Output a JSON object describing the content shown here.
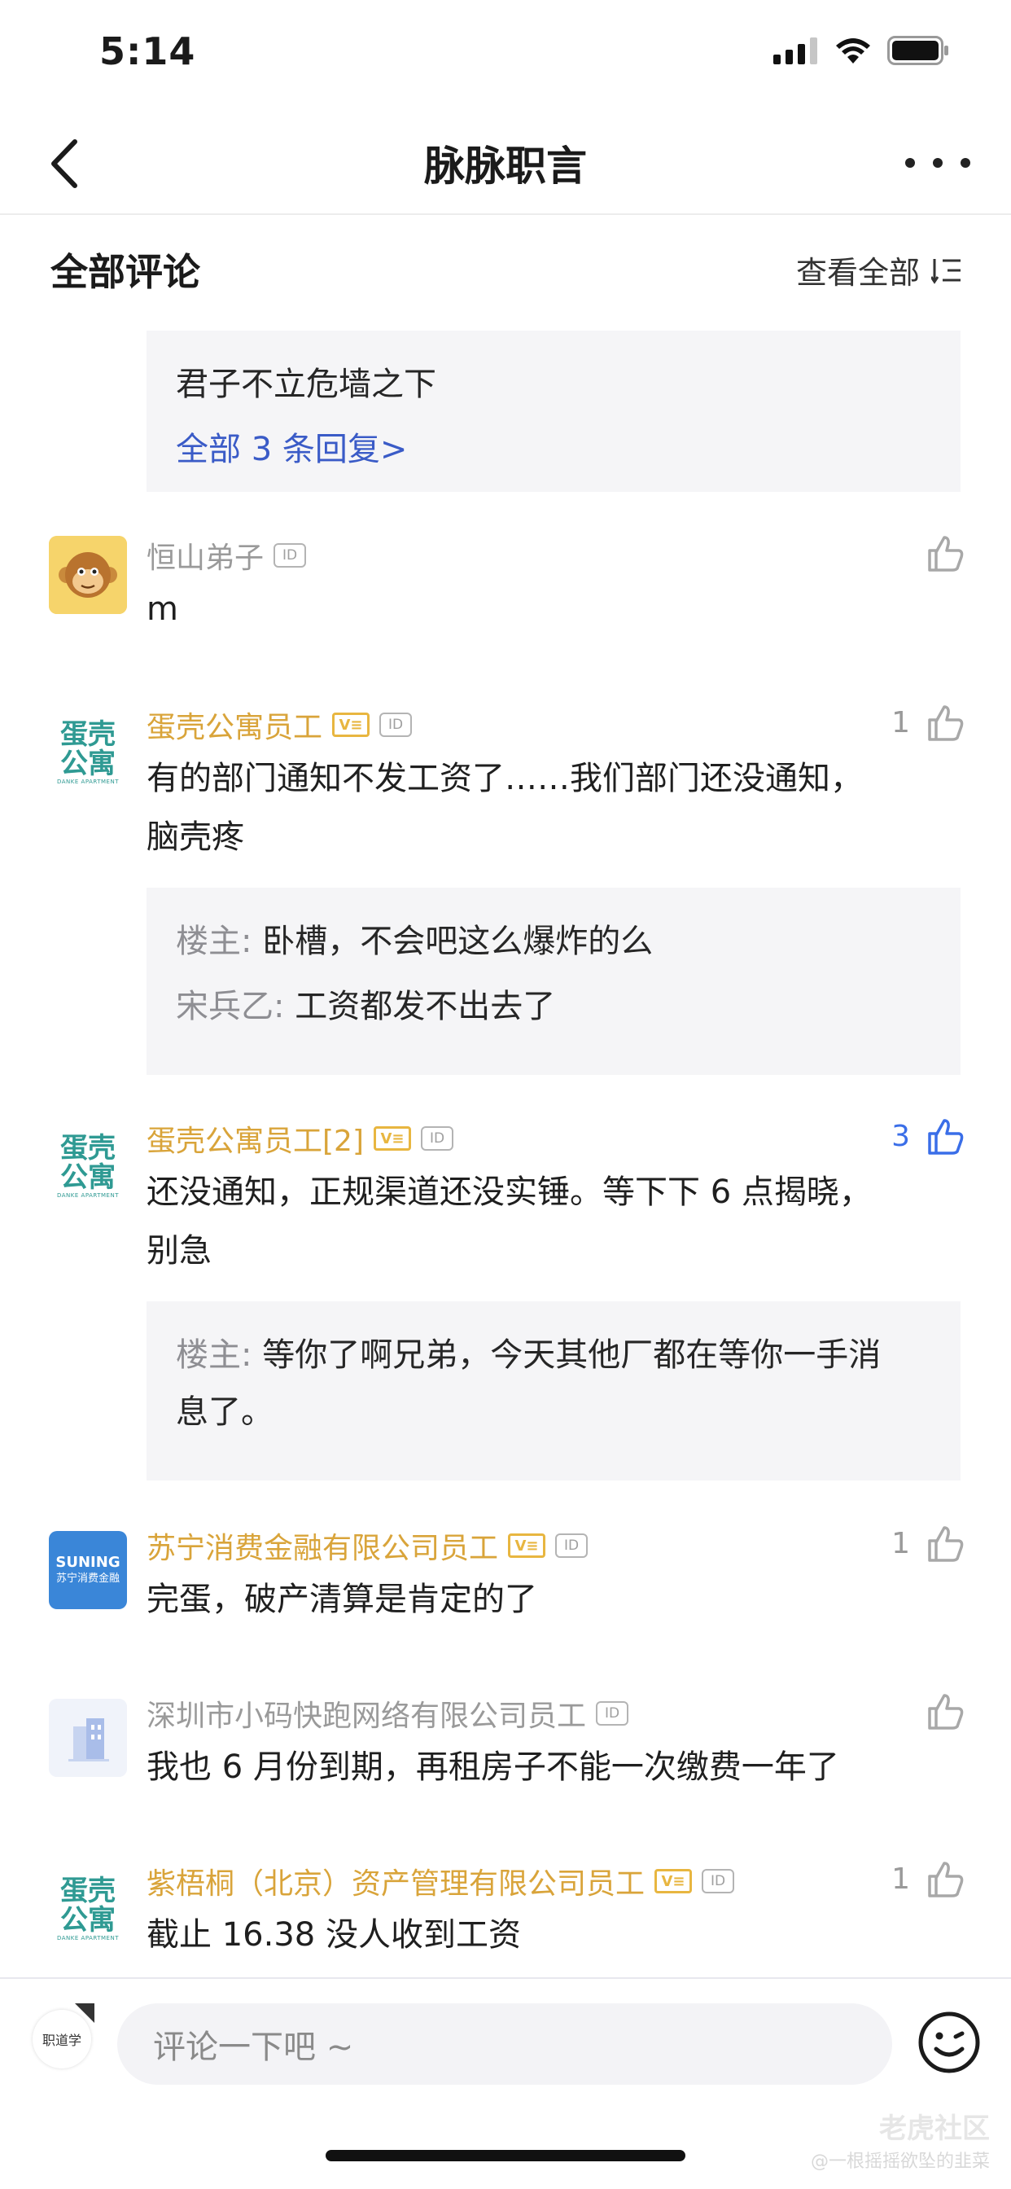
{
  "status_bar": {
    "time": "5:14"
  },
  "nav": {
    "title": "脉脉职言"
  },
  "section": {
    "title": "全部评论",
    "view_all": "查看全部"
  },
  "top_reply": {
    "text": "君子不立危墙之下",
    "more": "全部 3 条回复>"
  },
  "comments": [
    {
      "author": "恒山弟子",
      "text": "m",
      "likes": ""
    },
    {
      "author": "蛋壳公寓员工",
      "text_line1": "有的部门通知不发工资了……我们部门还没通知，",
      "text_line2": "脑壳疼",
      "likes": "1",
      "replies": [
        {
          "author": "楼主:",
          "text": "卧槽，不会吧这么爆炸的么"
        },
        {
          "author": "宋兵乙:",
          "text": "工资都发不出去了"
        }
      ]
    },
    {
      "author": "蛋壳公寓员工[2]",
      "text_line1": "还没通知，正规渠道还没实锤。等下下 6 点揭晓，",
      "text_line2": "别急",
      "likes": "3",
      "replies": [
        {
          "author": "楼主:",
          "text": "等你了啊兄弟，今天其他厂都在等你一手消",
          "text2": "息了。"
        }
      ]
    },
    {
      "author": "苏宁消费金融有限公司员工",
      "text": "完蛋，破产清算是肯定的了",
      "likes": "1"
    },
    {
      "author": "深圳市小码快跑网络有限公司员工",
      "text": "我也 6 月份到期，再租房子不能一次缴费一年了",
      "likes": ""
    },
    {
      "author": "紫梧桐（北京）资产管理有限公司员工",
      "text": "截止 16.38 没人收到工资",
      "likes": "1"
    }
  ],
  "avatars": {
    "danke_cn": "蛋壳\n公寓",
    "danke_en": "DANKE APARTMENT",
    "suning_en": "SUNING",
    "suning_cn": "苏宁消费金融"
  },
  "badges": {
    "id": "ID",
    "v": "V"
  },
  "bottom_bar": {
    "placeholder": "评论一下吧 ~",
    "mini_avatar_label": "职道学"
  },
  "watermark": {
    "main": "老虎社区",
    "sub": "@一根摇摇欲坠的韭菜"
  },
  "colors": {
    "accent": "#3a6ee8",
    "author_gold": "#d9a43a",
    "link_blue": "#3a5bc7"
  }
}
